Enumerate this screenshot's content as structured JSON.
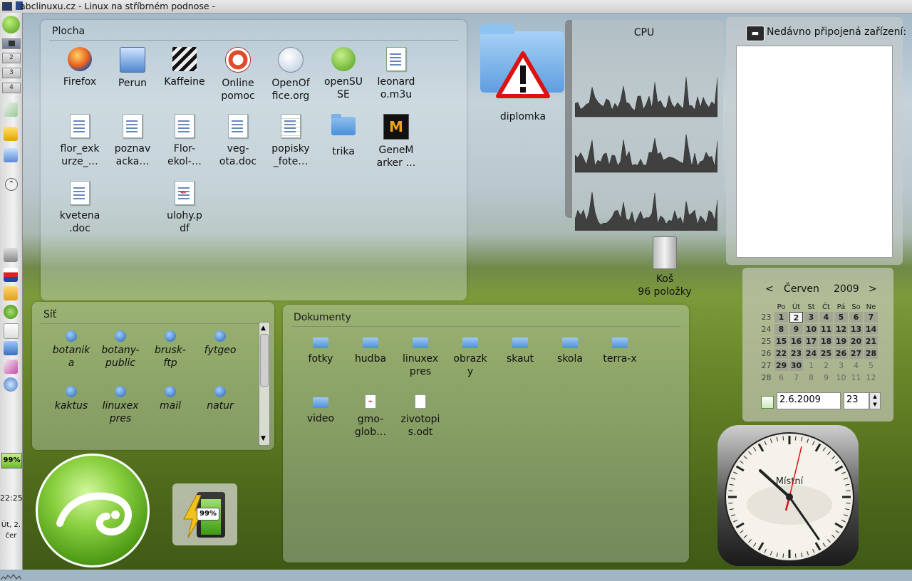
{
  "titlebar": {
    "title": "abclinuxu.cz - Linux na stříbrném podnose -"
  },
  "leftpanel": {
    "pager": [
      "2",
      "3",
      "4"
    ],
    "battery": "99%",
    "time": "22:25",
    "date_line1": "Út, 2.",
    "date_line2": "čer"
  },
  "plocha": {
    "title": "Plocha",
    "icons": [
      {
        "l1": "Firefox",
        "l2": "",
        "kind": "firefox"
      },
      {
        "l1": "Perun",
        "l2": "",
        "kind": "monitor"
      },
      {
        "l1": "Kaffeine",
        "l2": "",
        "kind": "clapper"
      },
      {
        "l1": "Online",
        "l2": "pomoc",
        "kind": "help"
      },
      {
        "l1": "OpenOf",
        "l2": "fice.org",
        "kind": "ooo"
      },
      {
        "l1": "openSU",
        "l2": "SE",
        "kind": "suse"
      },
      {
        "l1": "leonard",
        "l2": "o.m3u",
        "kind": "music"
      },
      {
        "l1": "flor_exk",
        "l2": "urze_…",
        "kind": "doc"
      },
      {
        "l1": "poznav",
        "l2": "acka…",
        "kind": "doc"
      },
      {
        "l1": "Flor-",
        "l2": "ekol-…",
        "kind": "doc"
      },
      {
        "l1": "veg-",
        "l2": "ota.doc",
        "kind": "doc"
      },
      {
        "l1": "popisky",
        "l2": "_fote…",
        "kind": "sheet"
      },
      {
        "l1": "trika",
        "l2": "",
        "kind": "folder"
      },
      {
        "l1": "GeneM",
        "l2": "arker …",
        "kind": "gm"
      },
      {
        "l1": "kvetena",
        "l2": ".doc",
        "kind": "doc"
      },
      {
        "l1": "",
        "l2": "",
        "kind": "none"
      },
      {
        "l1": "ulohy.p",
        "l2": "df",
        "kind": "pdf"
      }
    ]
  },
  "diplomka": {
    "label": "diplomka"
  },
  "cpu": {
    "title": "CPU"
  },
  "trash": {
    "label": "Koš",
    "count": "96 položky"
  },
  "devices": {
    "title": "Nedávno připojená zařízení:"
  },
  "sit": {
    "title": "Síť",
    "items": [
      {
        "l1": "botanik",
        "l2": "a"
      },
      {
        "l1": "botany-",
        "l2": "public"
      },
      {
        "l1": "brusk-",
        "l2": "ftp"
      },
      {
        "l1": "fytgeo",
        "l2": ""
      },
      {
        "l1": "kaktus",
        "l2": ""
      },
      {
        "l1": "linuxex",
        "l2": "pres"
      },
      {
        "l1": "mail",
        "l2": ""
      },
      {
        "l1": "natur",
        "l2": ""
      }
    ]
  },
  "dokumenty": {
    "title": "Dokumenty",
    "items": [
      {
        "l1": "fotky",
        "l2": "",
        "kind": "folder"
      },
      {
        "l1": "hudba",
        "l2": "",
        "kind": "folder"
      },
      {
        "l1": "linuxex",
        "l2": "pres",
        "kind": "folder"
      },
      {
        "l1": "obrazk",
        "l2": "y",
        "kind": "folder"
      },
      {
        "l1": "skaut",
        "l2": "",
        "kind": "folder"
      },
      {
        "l1": "skola",
        "l2": "",
        "kind": "folder"
      },
      {
        "l1": "terra-x",
        "l2": "",
        "kind": "folder"
      },
      {
        "l1": "video",
        "l2": "",
        "kind": "folder"
      },
      {
        "l1": "gmo-",
        "l2": "glob…",
        "kind": "pdf"
      },
      {
        "l1": "zivotopi",
        "l2": "s.odt",
        "kind": "odt"
      }
    ]
  },
  "calendar": {
    "prev": "<",
    "next": ">",
    "month": "Červen",
    "year": "2009",
    "weekdays": [
      "Po",
      "Út",
      "St",
      "Čt",
      "Pá",
      "So",
      "Ne"
    ],
    "weeks": [
      {
        "wk": "23",
        "days": [
          "1",
          "2",
          "3",
          "4",
          "5",
          "6",
          "7"
        ]
      },
      {
        "wk": "24",
        "days": [
          "8",
          "9",
          "10",
          "11",
          "12",
          "13",
          "14"
        ]
      },
      {
        "wk": "25",
        "days": [
          "15",
          "16",
          "17",
          "18",
          "19",
          "20",
          "21"
        ]
      },
      {
        "wk": "26",
        "days": [
          "22",
          "23",
          "24",
          "25",
          "26",
          "27",
          "28"
        ]
      },
      {
        "wk": "27",
        "days": [
          "29",
          "30",
          "1",
          "2",
          "3",
          "4",
          "5"
        ]
      },
      {
        "wk": "28",
        "days": [
          "6",
          "7",
          "8",
          "9",
          "10",
          "11",
          "12"
        ]
      }
    ],
    "date_value": "2.6.2009",
    "week_value": "23"
  },
  "clock": {
    "label": "Místní"
  },
  "battery_widget": {
    "percent": "99%"
  },
  "colors": {
    "accent_green": "#6fbf3a",
    "panel_tint": "#dfe9ec"
  }
}
